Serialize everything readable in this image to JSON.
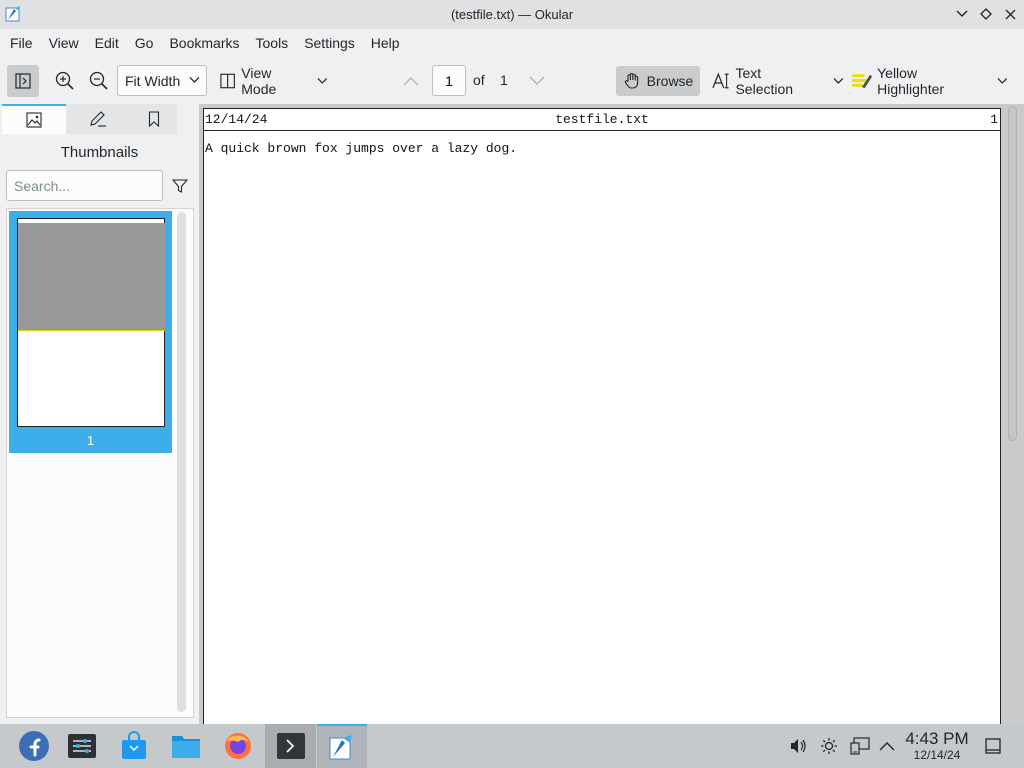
{
  "window": {
    "title": "(testfile.txt) — Okular"
  },
  "menubar": {
    "items": [
      "File",
      "View",
      "Edit",
      "Go",
      "Bookmarks",
      "Tools",
      "Settings",
      "Help"
    ]
  },
  "toolbar": {
    "zoom_mode": "Fit Width",
    "view_mode_label": "View Mode",
    "current_page": "1",
    "of_label": "of",
    "total_pages": "1",
    "browse_label": "Browse",
    "text_selection_label": "Text Selection",
    "highlighter_label": "Yellow Highlighter"
  },
  "sidebar": {
    "title": "Thumbnails",
    "search_placeholder": "Search...",
    "thumbnail_page_label": "1"
  },
  "document": {
    "header_date": "12/14/24",
    "header_filename": "testfile.txt",
    "header_page": "1",
    "body_text": "A quick brown fox jumps over a lazy dog."
  },
  "taskbar": {
    "time": "4:43 PM",
    "date": "12/14/24"
  },
  "colors": {
    "accent": "#3daee9",
    "highlighter": "#e8e000"
  }
}
